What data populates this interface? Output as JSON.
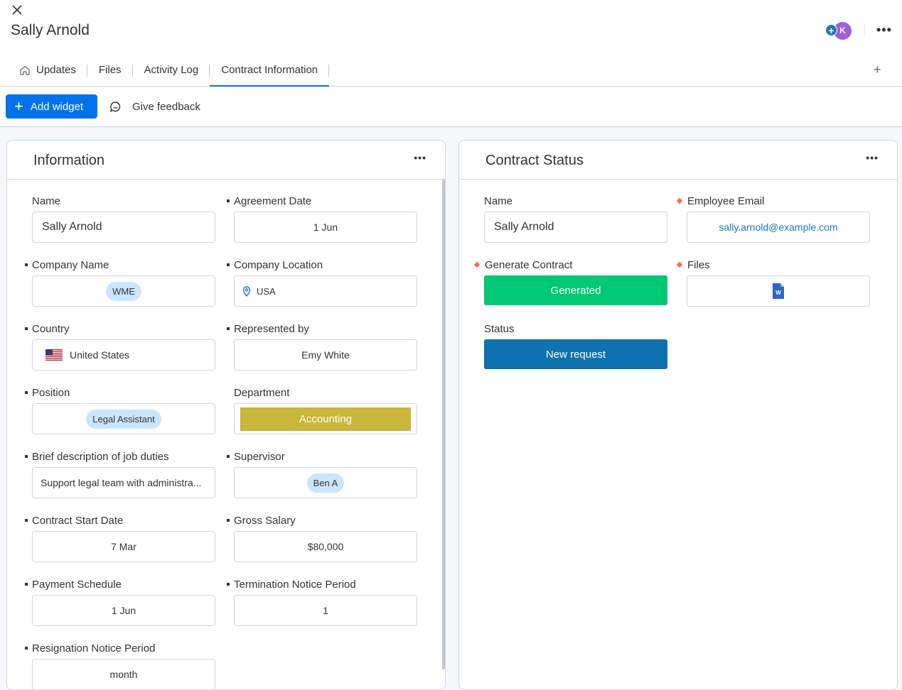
{
  "header": {
    "title": "Sally Arnold",
    "avatar_initial": "K",
    "avatar_add": "+",
    "more": "•••"
  },
  "tabs": [
    {
      "label": "Updates",
      "icon": "home-icon"
    },
    {
      "label": "Files"
    },
    {
      "label": "Activity Log"
    },
    {
      "label": "Contract Information",
      "active": true
    }
  ],
  "tab_add": "+",
  "toolbar": {
    "add_widget": "Add widget",
    "add_widget_icon": "+",
    "feedback": "Give feedback"
  },
  "information": {
    "title": "Information",
    "more": "•••",
    "fields": {
      "name": {
        "label": "Name",
        "value": "Sally Arnold"
      },
      "agreement_date": {
        "label": "Agreement Date",
        "value": "1 Jun"
      },
      "company_name": {
        "label": "Company Name",
        "value": "WME"
      },
      "company_location": {
        "label": "Company Location",
        "value": "USA"
      },
      "country": {
        "label": "Country",
        "value": "United States"
      },
      "represented_by": {
        "label": "Represented by",
        "value": "Emy White"
      },
      "position": {
        "label": "Position",
        "value": "Legal Assistant"
      },
      "department": {
        "label": "Department",
        "value": "Accounting",
        "color": "#c9b63a"
      },
      "job_duties": {
        "label": "Brief description of job duties",
        "value": "Support legal team with administra..."
      },
      "supervisor": {
        "label": "Supervisor",
        "value": "Ben A"
      },
      "contract_start": {
        "label": "Contract Start Date",
        "value": "7 Mar"
      },
      "gross_salary": {
        "label": "Gross Salary",
        "value": "$80,000"
      },
      "payment_schedule": {
        "label": "Payment Schedule",
        "value": "1 Jun"
      },
      "termination_notice": {
        "label": "Termination Notice Period",
        "value": "1"
      },
      "resignation_notice": {
        "label": "Resignation Notice Period",
        "value": "month"
      }
    }
  },
  "contract_status": {
    "title": "Contract Status",
    "more": "•••",
    "fields": {
      "name": {
        "label": "Name",
        "value": "Sally Arnold"
      },
      "employee_email": {
        "label": "Employee Email",
        "value": "sally.arnold@example.com"
      },
      "generate_contract": {
        "label": "Generate Contract",
        "value": "Generated",
        "color": "#00c875"
      },
      "files": {
        "label": "Files",
        "file_icon": "word-doc-icon",
        "file_letter": "W"
      },
      "status": {
        "label": "Status",
        "value": "New request",
        "color": "#0f72b0"
      }
    }
  }
}
